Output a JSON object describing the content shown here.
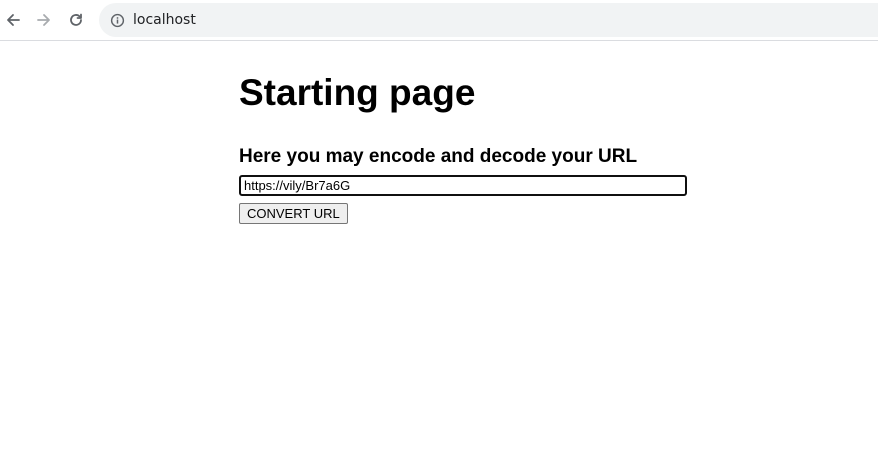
{
  "browser": {
    "url": "localhost",
    "icons": {
      "back": "arrow-left-icon",
      "forward": "arrow-right-icon",
      "reload": "reload-icon",
      "site_info": "info-circle-icon"
    }
  },
  "page": {
    "title": "Starting page",
    "subtitle": "Here you may encode and decode your URL",
    "url_input_value": "https://vily/Br7a6G",
    "convert_button_label": "CONVERT URL"
  }
}
